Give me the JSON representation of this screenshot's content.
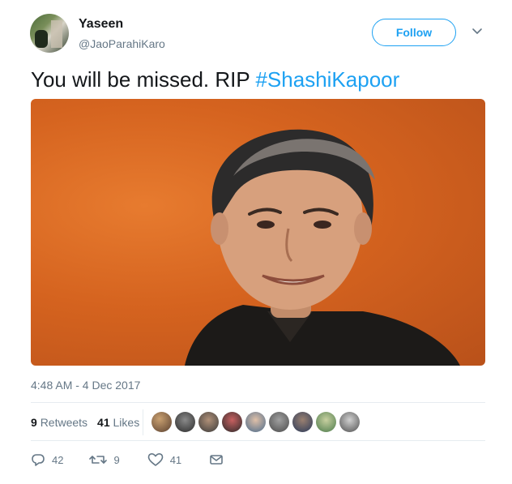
{
  "author": {
    "name": "Yaseen",
    "handle": "@JaoParahiKaro"
  },
  "follow_label": "Follow",
  "tweet": {
    "text": "You will be missed. RIP ",
    "hashtag": "#ShashiKapoor"
  },
  "timestamp": "4:48 AM - 4 Dec 2017",
  "stats": {
    "retweets_count": "9",
    "retweets_label": "Retweets",
    "likes_count": "41",
    "likes_label": "Likes"
  },
  "likers_count": 9,
  "actions": {
    "replies": "42",
    "retweets": "9",
    "likes": "41"
  },
  "icons": [
    "caret-down-icon",
    "reply-icon",
    "retweet-icon",
    "heart-icon",
    "message-icon"
  ],
  "colors": {
    "accent": "#1da1f2",
    "secondary_text": "#657786",
    "primary_text": "#14171a"
  }
}
